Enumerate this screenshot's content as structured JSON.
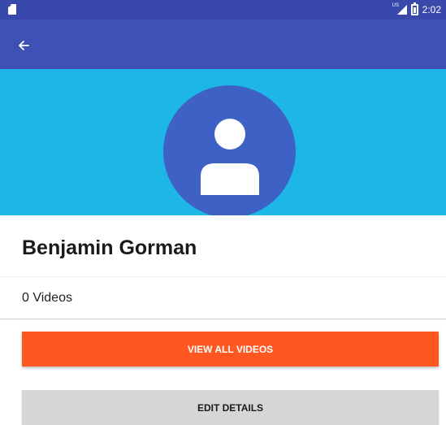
{
  "status_bar": {
    "time": "2:02",
    "network_label": "US",
    "icons": [
      "sim-card-icon",
      "cellular-signal-icon",
      "battery-icon"
    ]
  },
  "app_bar": {
    "back_icon": "arrow-back-icon",
    "color": "#3f51b5"
  },
  "profile": {
    "banner_color": "#1eb6e6",
    "avatar_color": "#3d61c4",
    "avatar_icon": "person-icon",
    "name": "Benjamin Gorman",
    "video_count_label": "0 Videos"
  },
  "actions": {
    "view_all_label": "VIEW ALL VIDEOS",
    "view_all_color": "#ff5722",
    "edit_label": "EDIT DETAILS",
    "edit_color": "#d6d6d6"
  }
}
